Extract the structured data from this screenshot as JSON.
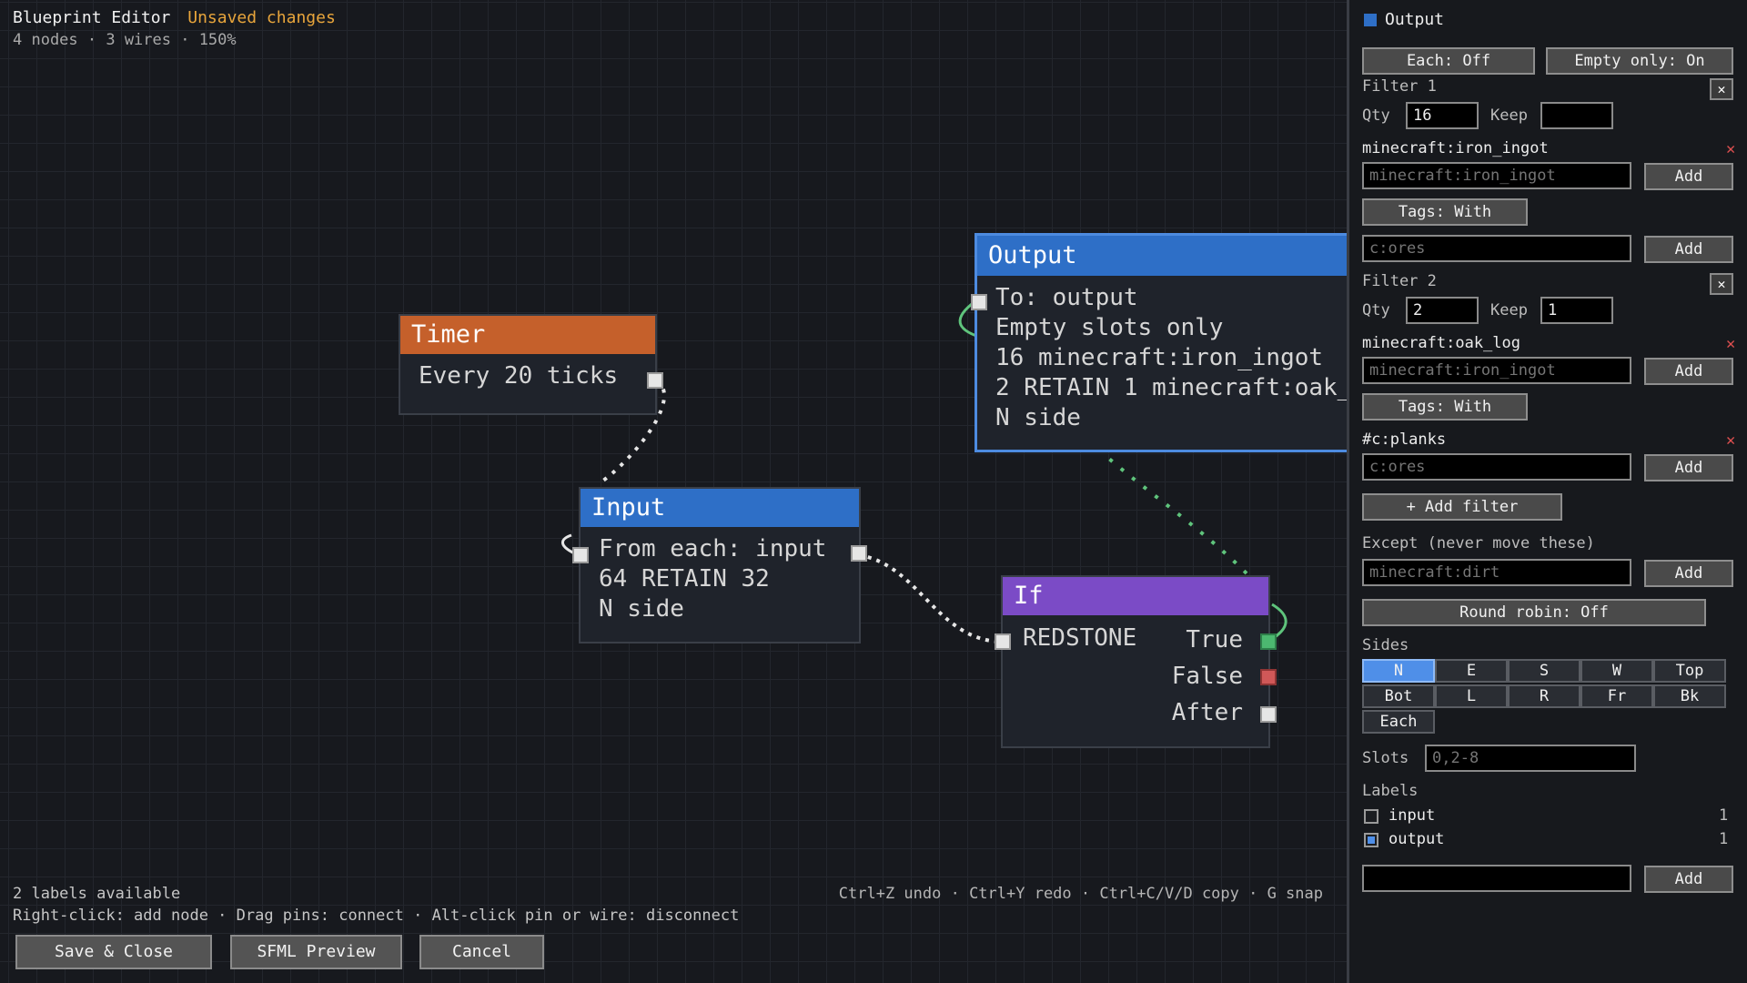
{
  "header": {
    "title": "Blueprint Editor",
    "status": "Unsaved changes",
    "info": "4 nodes · 3 wires · 150%"
  },
  "nodes": {
    "timer": {
      "title": "Timer",
      "lines": [
        "Every 20 ticks"
      ]
    },
    "input": {
      "title": "Input",
      "lines": [
        "From each: input",
        "64 RETAIN 32",
        "N side"
      ]
    },
    "output": {
      "title": "Output",
      "lines": [
        "To: output",
        "Empty slots only",
        "16 minecraft:iron_ingot",
        "2 RETAIN 1 minecraft:oak_",
        "N side"
      ]
    },
    "if": {
      "title": "If",
      "condition": "REDSTONE",
      "outputs": [
        "True",
        "False",
        "After"
      ]
    }
  },
  "footer": {
    "labels_available": "2 labels available",
    "hint": "Right-click: add node · Drag pins: connect · Alt-click pin or wire: disconnect",
    "shortcuts": "Ctrl+Z undo · Ctrl+Y redo · Ctrl+C/V/D copy · G snap",
    "buttons": {
      "save": "Save & Close",
      "preview": "SFML Preview",
      "cancel": "Cancel"
    }
  },
  "panel": {
    "title": "Output",
    "each_toggle": "Each: Off",
    "empty_toggle": "Empty only: On",
    "filters": [
      {
        "title": "Filter 1",
        "qty_label": "Qty",
        "qty_value": "16",
        "keep_label": "Keep",
        "keep_value": "",
        "item": "minecraft:iron_ingot",
        "item_input_placeholder": "minecraft:iron_ingot",
        "tags_toggle": "Tags: With",
        "tag_input_placeholder": "c:ores",
        "tag": ""
      },
      {
        "title": "Filter 2",
        "qty_label": "Qty",
        "qty_value": "2",
        "keep_label": "Keep",
        "keep_value": "1",
        "item": "minecraft:oak_log",
        "item_input_placeholder": "minecraft:iron_ingot",
        "tags_toggle": "Tags: With",
        "tag_input_placeholder": "c:ores",
        "tag": "#c:planks"
      }
    ],
    "add_label": "Add",
    "add_filter": "+ Add filter",
    "except_label": "Except (never move these)",
    "except_placeholder": "minecraft:dirt",
    "round_robin": "Round robin: Off",
    "sides_label": "Sides",
    "sides": [
      "N",
      "E",
      "S",
      "W",
      "Top",
      "Bot",
      "L",
      "R",
      "Fr",
      "Bk",
      "Each"
    ],
    "active_side": "N",
    "slots_label": "Slots",
    "slots_placeholder": "0,2-8",
    "labels_header": "Labels",
    "labels": [
      {
        "name": "input",
        "count": "1",
        "checked": false
      },
      {
        "name": "output",
        "count": "1",
        "checked": true
      }
    ],
    "new_label_value": ""
  },
  "colors": {
    "timer": "#c5602b",
    "input": "#2e6fc7",
    "output": "#2e6fc7",
    "if": "#7b4bc6",
    "unsaved": "#e8a53b",
    "active_side": "#4f8fe8",
    "wire_selected": "#5fc47c",
    "pin_true": "#4cb870",
    "pin_false": "#d05858"
  }
}
